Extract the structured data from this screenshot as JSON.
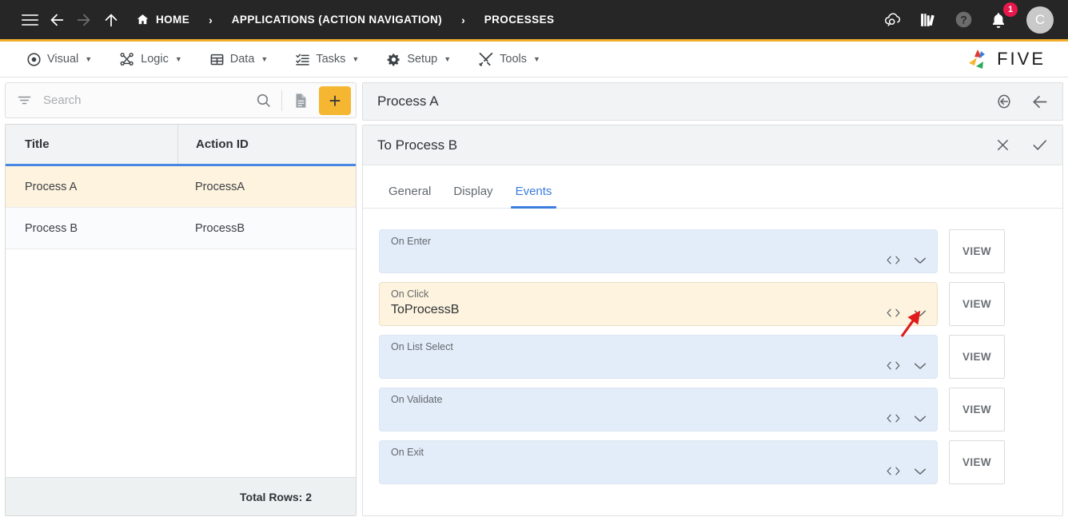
{
  "topbar": {
    "icons": [
      {
        "name": "menu-icon",
        "label": "Menu"
      },
      {
        "name": "back-icon",
        "label": "Back"
      },
      {
        "name": "forward-icon",
        "label": "Forward"
      },
      {
        "name": "up-icon",
        "label": "Up"
      }
    ],
    "breadcrumbs": [
      {
        "label": "HOME",
        "icon": "home-icon"
      },
      {
        "label": "APPLICATIONS (ACTION NAVIGATION)",
        "icon": ""
      },
      {
        "label": "PROCESSES",
        "icon": ""
      }
    ],
    "separator": "›",
    "right_icons": [
      {
        "name": "cloud-search-icon",
        "label": "Cloud Search"
      },
      {
        "name": "library-icon",
        "label": "Library"
      },
      {
        "name": "help-icon",
        "label": "Help"
      },
      {
        "name": "notifications-icon",
        "label": "Notifications"
      }
    ],
    "notification_count": "1",
    "avatar_initial": "C",
    "accent_bar_color": "#f0ae2b",
    "background_color": "#262626"
  },
  "menubar": {
    "items": [
      {
        "label": "Visual",
        "icon": "eye-icon"
      },
      {
        "label": "Logic",
        "icon": "flow-icon"
      },
      {
        "label": "Data",
        "icon": "table-icon"
      },
      {
        "label": "Tasks",
        "icon": "list-check-icon"
      },
      {
        "label": "Setup",
        "icon": "gear-icon"
      },
      {
        "label": "Tools",
        "icon": "tools-icon"
      }
    ],
    "caret": "▼",
    "logo_text": "FIVE"
  },
  "left_panel": {
    "search": {
      "placeholder": "Search",
      "value": "",
      "filter_icon": "filter-icon",
      "search_icon": "search-icon",
      "document_icon": "document-icon",
      "add_label": "+",
      "add_color": "#f5b731"
    },
    "grid": {
      "columns": [
        "Title",
        "Action ID"
      ],
      "rows": [
        {
          "title": "Process A",
          "action_id": "ProcessA",
          "selected": true
        },
        {
          "title": "Process B",
          "action_id": "ProcessB",
          "selected": false
        }
      ],
      "footer": "Total Rows: 2",
      "header_underline_color": "#4688e3",
      "selected_row_color": "#fdf3de"
    }
  },
  "right_panel": {
    "header": {
      "title": "Process A",
      "actions": [
        {
          "name": "revert-icon",
          "label": "Revert"
        },
        {
          "name": "back-arrow-icon",
          "label": "Back"
        }
      ]
    },
    "card": {
      "title": "To Process B",
      "actions": [
        {
          "name": "close-icon",
          "label": "Cancel"
        },
        {
          "name": "check-icon",
          "label": "Confirm"
        }
      ],
      "tabs": [
        {
          "label": "General",
          "active": false
        },
        {
          "label": "Display",
          "active": false
        },
        {
          "label": "Events",
          "active": true
        }
      ],
      "active_tab_color": "#3b7ddd",
      "events": [
        {
          "label": "On Enter",
          "value": "",
          "highlighted": false,
          "button": "VIEW"
        },
        {
          "label": "On Click",
          "value": "ToProcessB",
          "highlighted": true,
          "button": "VIEW"
        },
        {
          "label": "On List Select",
          "value": "",
          "highlighted": false,
          "button": "VIEW"
        },
        {
          "label": "On Validate",
          "value": "",
          "highlighted": false,
          "button": "VIEW"
        },
        {
          "label": "On Exit",
          "value": "",
          "highlighted": false,
          "button": "VIEW"
        }
      ],
      "event_icons": [
        {
          "name": "code-icon",
          "label": "Code"
        },
        {
          "name": "chevron-down-icon",
          "label": "Expand"
        }
      ]
    }
  },
  "annotation": {
    "type": "red-arrow",
    "color": "#e01b1b",
    "points_to": "on-click-chevron-down-icon"
  }
}
